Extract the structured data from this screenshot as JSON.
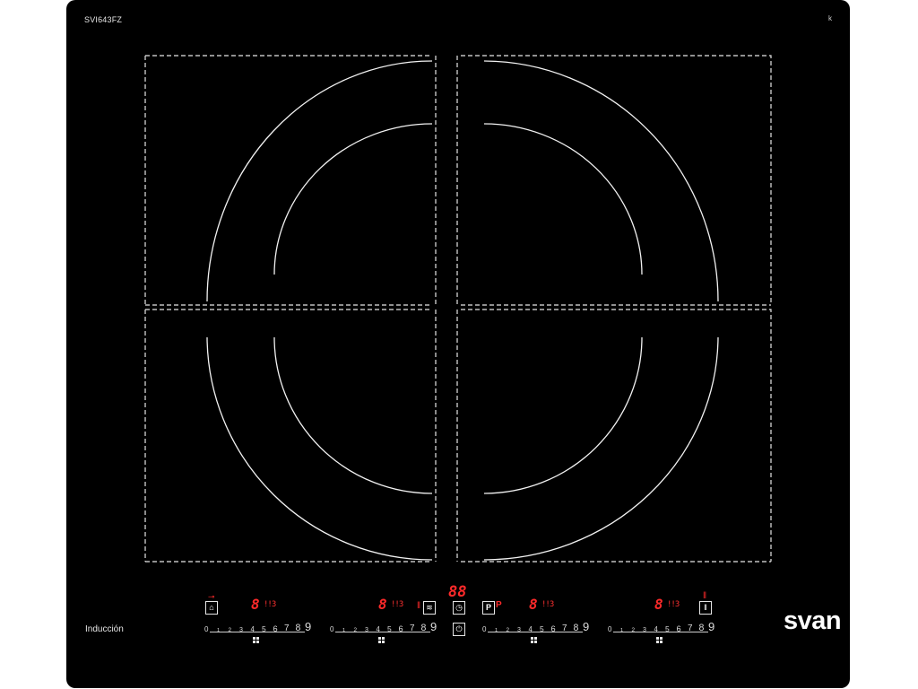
{
  "model": "SVI643FZ",
  "corner_mark": "k",
  "footer_label": "Inducción",
  "brand": "svan",
  "timer_display": "88",
  "zones": [
    {
      "id": "zone-1",
      "display": "8",
      "sub_display": "!!3",
      "lock_label": "",
      "slider_levels": [
        "0",
        "1",
        "2",
        "3",
        "4",
        "5",
        "6",
        "7",
        "8",
        "9"
      ]
    },
    {
      "id": "zone-2",
      "display": "8",
      "sub_display": "!!3",
      "slider_levels": [
        "0",
        "1",
        "2",
        "3",
        "4",
        "5",
        "6",
        "7",
        "8",
        "9"
      ]
    },
    {
      "id": "zone-3",
      "display": "8",
      "sub_display": "!!3",
      "pause_label": "P",
      "slider_levels": [
        "0",
        "1",
        "2",
        "3",
        "4",
        "5",
        "6",
        "7",
        "8",
        "9"
      ]
    },
    {
      "id": "zone-4",
      "display": "8",
      "sub_display": "!!3",
      "slider_levels": [
        "0",
        "1",
        "2",
        "3",
        "4",
        "5",
        "6",
        "7",
        "8",
        "9"
      ]
    }
  ],
  "icons": {
    "lock": "lock-icon",
    "keep_warm": "heat-waves-icon",
    "timer": "timer-icon",
    "power": "power-icon",
    "pause": "pause-icon",
    "stop": "stop-icon",
    "bridge": "bridge-icon"
  },
  "colors": {
    "panel": "#000000",
    "display": "#ff2a2a",
    "lines": "#e6e6e6"
  }
}
